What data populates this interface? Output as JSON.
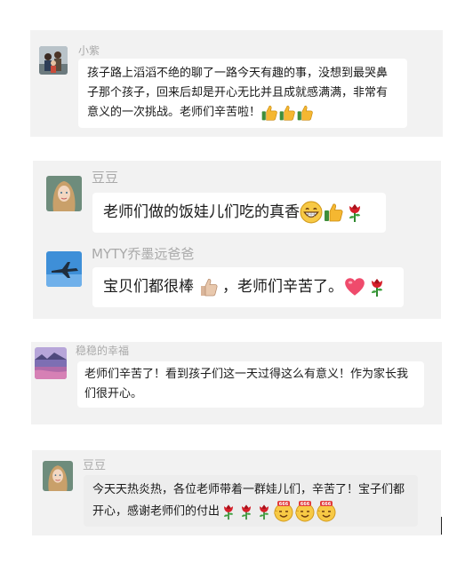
{
  "messages": [
    {
      "name": "小紫",
      "text": "孩子路上滔滔不绝的聊了一路今天有趣的事，没想到最哭鼻子那个孩子，回来后却是开心无比并且成就感满满，非常有意义的一次挑战。老师们辛苦啦！",
      "emoji": [
        "thumbs-up-icon",
        "thumbs-up-icon",
        "thumbs-up-icon"
      ]
    },
    {
      "name": "豆豆",
      "text": "老师们做的饭娃儿们吃的真香",
      "emoji": [
        "grin-icon",
        "thumbs-up-icon",
        "rose-icon"
      ]
    },
    {
      "name": "MYTY乔墨远爸爸",
      "text_before": "宝贝们都很棒",
      "text_after": "，老师们辛苦了。",
      "emoji_mid": "thumbs-up-icon",
      "emoji": [
        "heart-icon",
        "rose-icon"
      ]
    },
    {
      "name": "稳稳的幸福",
      "text": "老师们辛苦了！看到孩子们这一天过得这么有意义！作为家长我们很开心。"
    },
    {
      "name": "豆豆",
      "text": "今天天热炎热，各位老师带着一群娃儿们，辛苦了！宝子们都开心，感谢老师们的付出",
      "emoji": [
        "rose-icon",
        "rose-icon",
        "rose-icon",
        "666-face-icon",
        "666-face-icon",
        "666-face-icon"
      ]
    }
  ],
  "colors": {
    "panel": "#f2f2f2",
    "bubble": "#ffffff",
    "name": "#a9a9a9",
    "thumbs": "#f5b731",
    "rose": "#d6202a",
    "heart": "#ef4b6c"
  }
}
